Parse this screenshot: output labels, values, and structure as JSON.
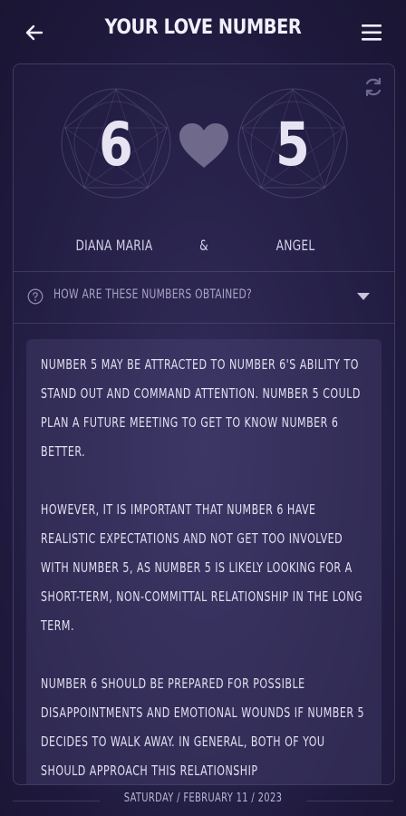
{
  "header": {
    "title": "YOUR LOVE NUMBER",
    "back_icon": "arrow-left-icon",
    "menu_icon": "hamburger-menu-icon"
  },
  "match": {
    "left_number": "6",
    "right_number": "5",
    "left_name": "DIANA MARIA",
    "connector": "&",
    "right_name": "ANGEL",
    "center_icon": "heart-icon",
    "refresh_icon": "refresh-icon"
  },
  "faq": {
    "label": "HOW ARE THESE NUMBERS OBTAINED?",
    "help_icon": "help-circle-icon",
    "toggle_icon": "chevron-down-icon"
  },
  "description": {
    "paragraphs": [
      "NUMBER 5 MAY BE ATTRACTED TO NUMBER 6'S ABILITY TO STAND OUT AND COMMAND ATTENTION. NUMBER 5 COULD PLAN A FUTURE MEETING TO GET TO KNOW NUMBER 6 BETTER.",
      "HOWEVER, IT IS IMPORTANT THAT NUMBER 6 HAVE REALISTIC EXPECTATIONS AND NOT GET TOO INVOLVED WITH NUMBER 5, AS NUMBER 5 IS LIKELY LOOKING FOR A SHORT-TERM, NON-COMMITTAL RELATIONSHIP IN THE LONG TERM.",
      "NUMBER 6 SHOULD BE PREPARED FOR POSSIBLE DISAPPOINTMENTS AND EMOTIONAL WOUNDS IF NUMBER 5 DECIDES TO WALK AWAY. IN GENERAL, BOTH OF YOU SHOULD APPROACH THIS RELATIONSHIP"
    ]
  },
  "footer": {
    "date": "SATURDAY / FEBRUARY 11 / 2023"
  },
  "colors": {
    "background": "#221d40",
    "text": "#e3dff0",
    "muted": "#a9a3c5",
    "heart": "#6f6a8c"
  }
}
